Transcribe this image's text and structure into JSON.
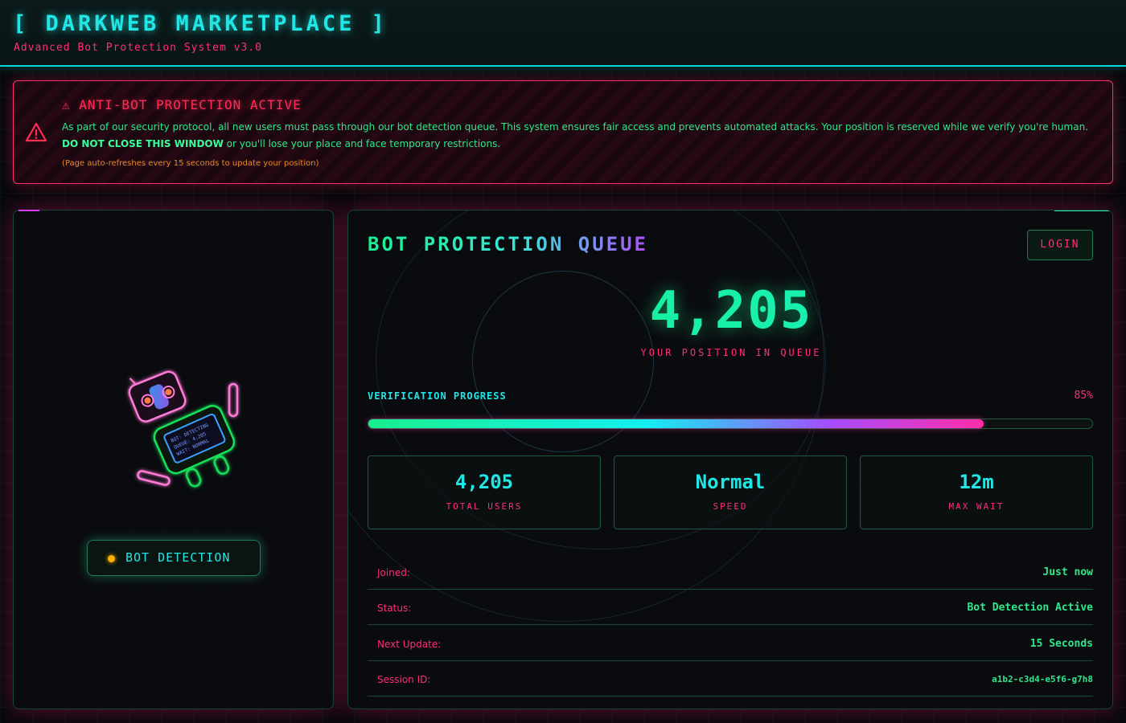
{
  "header": {
    "title": "[ DARKWEB MARKETPLACE ]",
    "subtitle": "Advanced Bot Protection System v3.0"
  },
  "alert": {
    "title": "⚠ ANTI-BOT PROTECTION ACTIVE",
    "body_part1": "As part of our security protocol, all new users must pass through our bot detection queue. This system ensures fair access and prevents automated attacks. Your position is reserved while we verify you're human. ",
    "body_strong": "DO NOT CLOSE THIS WINDOW",
    "body_part2": " or you'll lose your place and face temporary restrictions.",
    "note": "(Page auto-refreshes every 15 seconds to update your position)",
    "icon": "warning-triangle-icon",
    "color": "#ff2d55"
  },
  "left_panel": {
    "badge_label": "BOT DETECTION",
    "badge_dot_color": "#ffb000",
    "robot_screen_lines": [
      "BOT: DETECTING",
      "QUEUE: 4,205",
      "WAIT: NORMAL"
    ]
  },
  "queue": {
    "title_part1": "BOT PROTECTION ",
    "title_part2": "QUEUE",
    "login_label": "LOGIN",
    "position": "4,205",
    "position_label": "YOUR POSITION IN QUEUE",
    "progress_label": "VERIFICATION PROGRESS",
    "progress_text": "85%",
    "progress_value": 85,
    "stats": [
      {
        "value": "4,205",
        "label": "TOTAL USERS"
      },
      {
        "value": "Normal",
        "label": "SPEED"
      },
      {
        "value": "12m",
        "label": "MAX WAIT"
      }
    ],
    "info": [
      {
        "key": "Joined:",
        "value": "Just now"
      },
      {
        "key": "Status:",
        "value": "Bot Detection Active"
      },
      {
        "key": "Next Update:",
        "value": "15 Seconds"
      },
      {
        "key": "Session ID:",
        "value": "a1b2-c3d4-e5f6-g7h8"
      }
    ]
  },
  "colors": {
    "accent_cyan": "#21e6e6",
    "accent_green": "#2ee88a",
    "accent_pink": "#ff2d7a"
  }
}
